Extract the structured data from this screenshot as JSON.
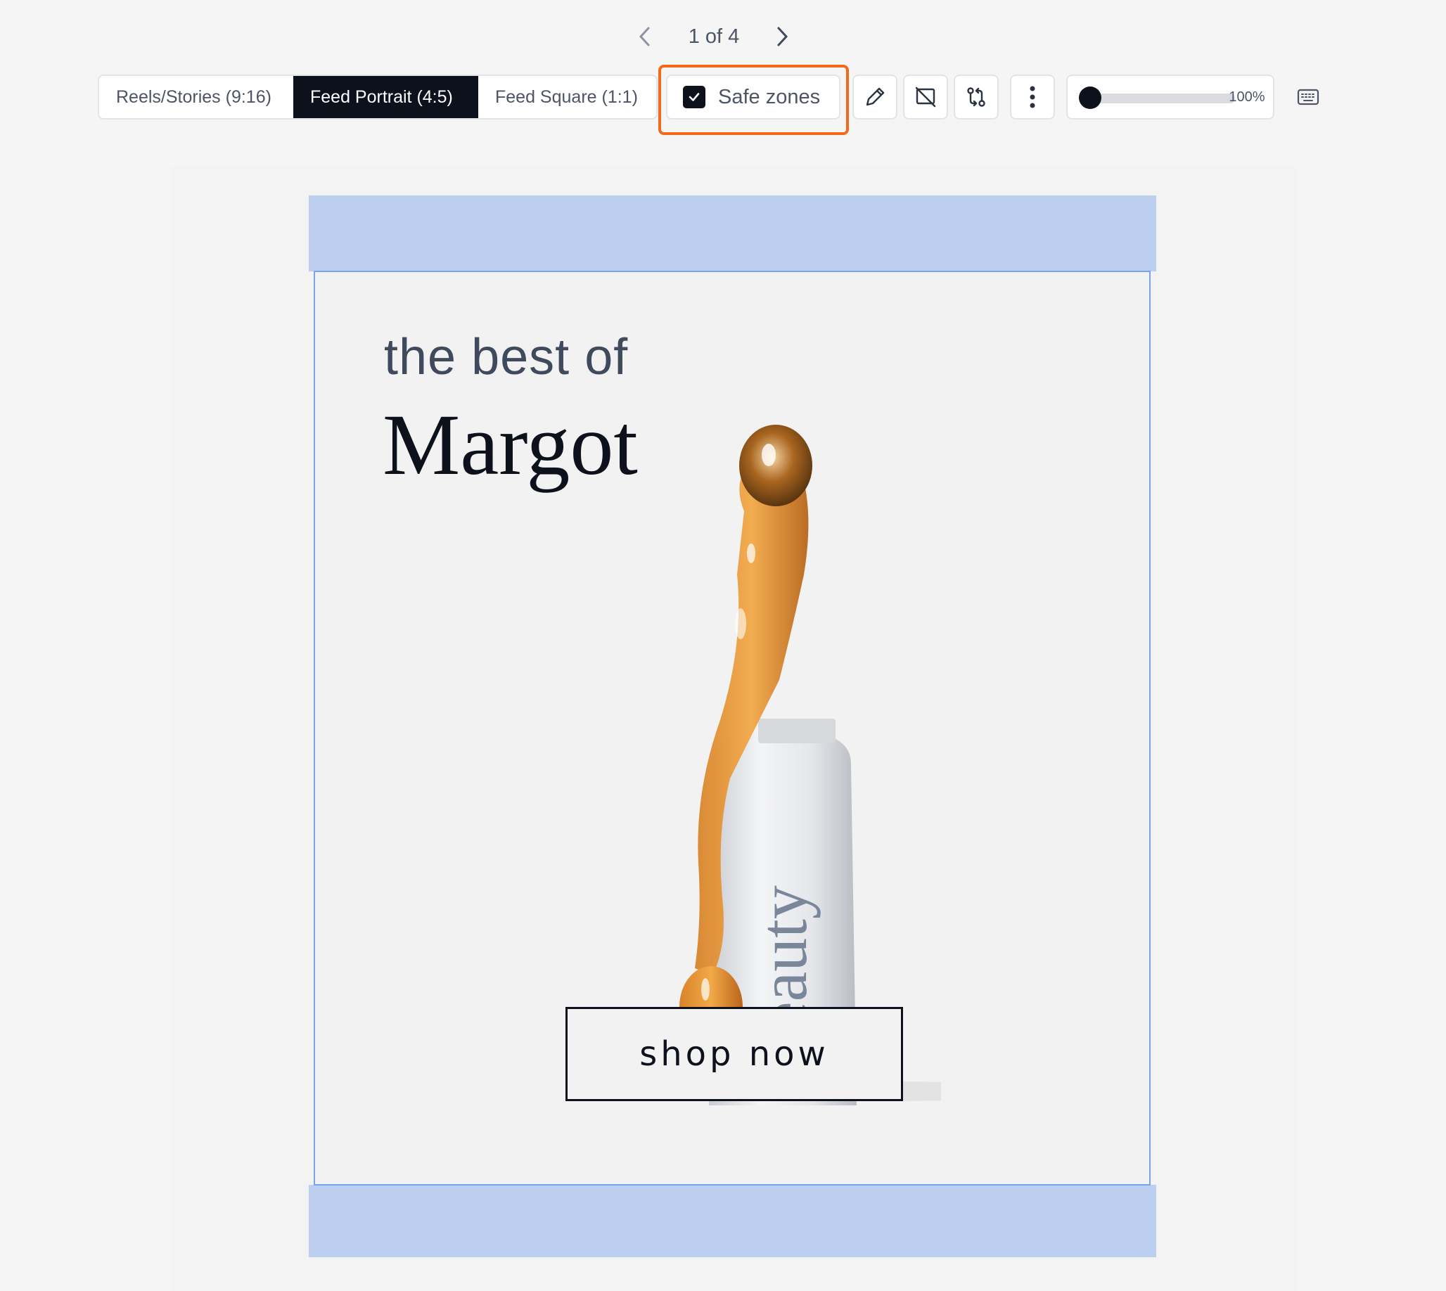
{
  "pager": {
    "label": "1 of 4",
    "prev": "previous",
    "next": "next"
  },
  "toolbar": {
    "formats": [
      "Reels/Stories (9:16)",
      "Feed Portrait (4:5)",
      "Feed Square (1:1)"
    ],
    "selected_format": "Feed Portrait (4:5)",
    "safe_zones_label": "Safe zones",
    "safe_zones_checked": true,
    "zoom_label": "100%",
    "zoom_value": 1.0,
    "icons": [
      "pencil-icon",
      "hide-frame-icon",
      "swap-icon",
      "more-vertical-icon",
      "keyboard-icon"
    ]
  },
  "creative": {
    "headline_small": "the best of",
    "headline_large": "Margot",
    "product_text": "eauty",
    "cta_label": "shop now"
  },
  "colors": {
    "highlight": "#f26b1d",
    "safe_zone_band": "#bccfef",
    "safe_zone_border": "#7aa3ee",
    "dark": "#0c111c"
  }
}
